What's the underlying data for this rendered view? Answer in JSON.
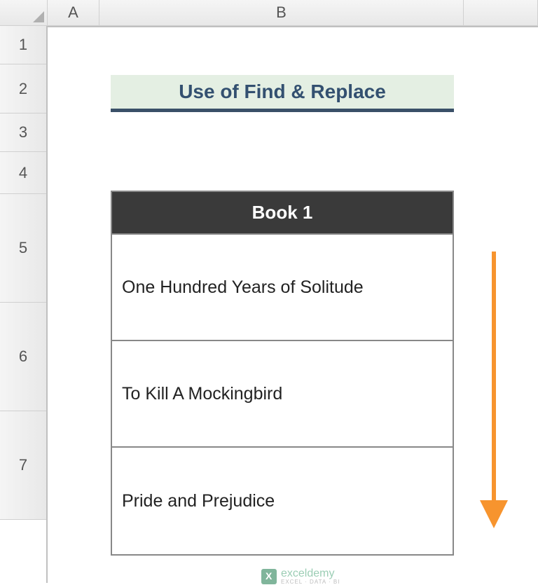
{
  "columns": {
    "a": "A",
    "b": "B"
  },
  "rows": {
    "r1": "1",
    "r2": "2",
    "r3": "3",
    "r4": "4",
    "r5": "5",
    "r6": "6",
    "r7": "7"
  },
  "title": "Use of Find & Replace",
  "table": {
    "header": "Book 1",
    "rows": [
      "One Hundred Years of Solitude",
      "To Kill A Mockingbird",
      "Pride and Prejudice"
    ]
  },
  "watermark": {
    "main": "exceldemy",
    "sub": "EXCEL · DATA · BI"
  }
}
